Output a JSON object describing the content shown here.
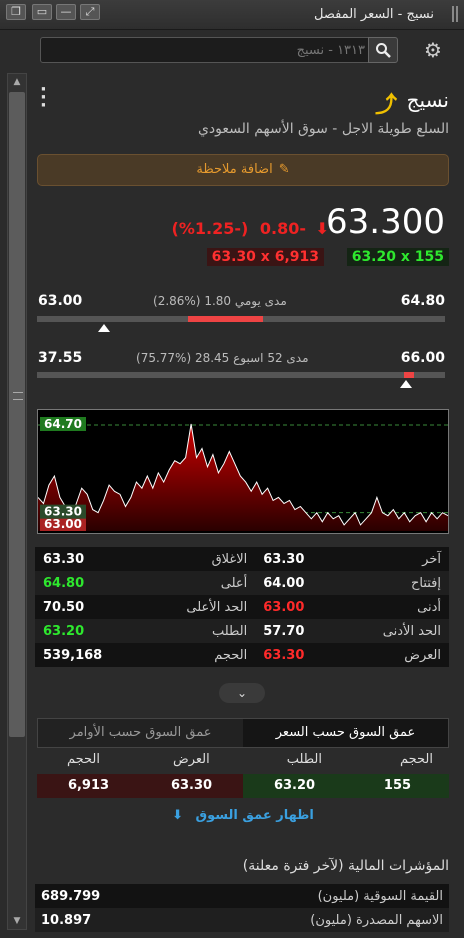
{
  "window": {
    "title": "نسيج - السعر المفصل",
    "btn_restore": "❐",
    "btn_min": "—",
    "btn_max": "▭",
    "btn_extra": "⤢"
  },
  "search": {
    "placeholder": "١٣١٣ - نسيج",
    "button_icon": "search-icon",
    "settings_icon": "gear-icon"
  },
  "header": {
    "company": "نسيج",
    "subtitle": "السلع طويلة الاجل - سوق الأسهم السعودي",
    "trend_icon": "trend-up-icon",
    "menu_icon": "kebab-menu-icon"
  },
  "note_button": {
    "label": "اضافة ملاحظة",
    "icon": "edit-icon",
    "color": "#e69a2e"
  },
  "quote": {
    "last": "63.300",
    "change": "0.80-",
    "change_pct": "(%1.25-)",
    "bid": "63.20 x 155",
    "ask": "63.30 x 6,913",
    "up_color": "#2ee82e",
    "down_color": "#ff2a2a"
  },
  "daily_range": {
    "low": "63.00",
    "high": "64.80",
    "label": "مدى يومي 1.80 (%2.86)",
    "fill_start_frac": 0.37,
    "fill_end_frac": 0.555,
    "marker_frac": 0.165
  },
  "week52_range": {
    "low": "37.55",
    "high": "66.00",
    "label": "مدى 52 اسبوع 28.45 (%75.77)",
    "fill_start_frac": 0.9,
    "fill_end_frac": 0.925,
    "marker_frac": 0.905
  },
  "chart_data": {
    "type": "area",
    "ylim": [
      63.0,
      64.75
    ],
    "top_tag": "64.70",
    "bottom_tag": "63.30",
    "bottom_tag2": "63.00",
    "values": [
      63.55,
      63.45,
      63.75,
      63.9,
      63.55,
      63.4,
      63.2,
      63.45,
      63.7,
      63.6,
      63.35,
      63.3,
      63.5,
      63.75,
      63.65,
      63.6,
      63.4,
      63.55,
      63.8,
      63.7,
      63.9,
      63.7,
      63.95,
      63.8,
      64.0,
      64.15,
      64.1,
      64.2,
      64.75,
      64.2,
      64.35,
      64.05,
      64.25,
      63.95,
      64.1,
      64.3,
      64.1,
      63.9,
      63.8,
      63.65,
      63.8,
      63.6,
      63.7,
      63.5,
      63.55,
      63.45,
      63.5,
      63.35,
      63.4,
      63.3,
      63.2,
      63.3,
      63.15,
      63.3,
      63.2,
      63.25,
      63.1,
      63.2,
      63.3,
      63.1,
      63.2,
      63.3,
      63.55,
      63.3,
      63.25,
      63.35,
      63.2,
      63.3,
      63.15,
      63.25,
      63.3,
      63.15,
      63.3,
      63.2,
      63.3,
      63.25
    ]
  },
  "stats": [
    {
      "l1": "آخر",
      "v1": "63.30",
      "c1": "",
      "l2": "الاغلاق",
      "v2": "63.30",
      "c2": ""
    },
    {
      "l1": "إفتتاح",
      "v1": "64.00",
      "c1": "",
      "l2": "أعلى",
      "v2": "64.80",
      "c2": "green"
    },
    {
      "l1": "أدنى",
      "v1": "63.00",
      "c1": "red",
      "l2": "الحد الأعلى",
      "v2": "70.50",
      "c2": ""
    },
    {
      "l1": "الحد الأدنى",
      "v1": "57.70",
      "c1": "",
      "l2": "الطلب",
      "v2": "63.20",
      "c2": "green"
    },
    {
      "l1": "العرض",
      "v1": "63.30",
      "c1": "red",
      "l2": "الحجم",
      "v2": "539,168",
      "c2": ""
    }
  ],
  "expand_icon": "chevron-down-icon",
  "depth": {
    "tab_price": "عمق السوق حسب السعر",
    "tab_orders": "عمق السوق حسب الأوامر",
    "head_qty_bid": "الحجم",
    "head_bid": "الطلب",
    "head_ask": "العرض",
    "head_qty_ask": "الحجم",
    "bid_qty": "155",
    "bid": "63.20",
    "ask": "63.30",
    "ask_qty": "6,913",
    "show_label": "اظهار عمق السوق"
  },
  "financials": {
    "title": "المؤشرات المالية (لآخر فترة معلنة)",
    "rows": [
      {
        "label": "القيمة السوقية (مليون)",
        "value": "689.799"
      },
      {
        "label": "الاسهم المصدرة (مليون)",
        "value": "10.897"
      }
    ]
  }
}
